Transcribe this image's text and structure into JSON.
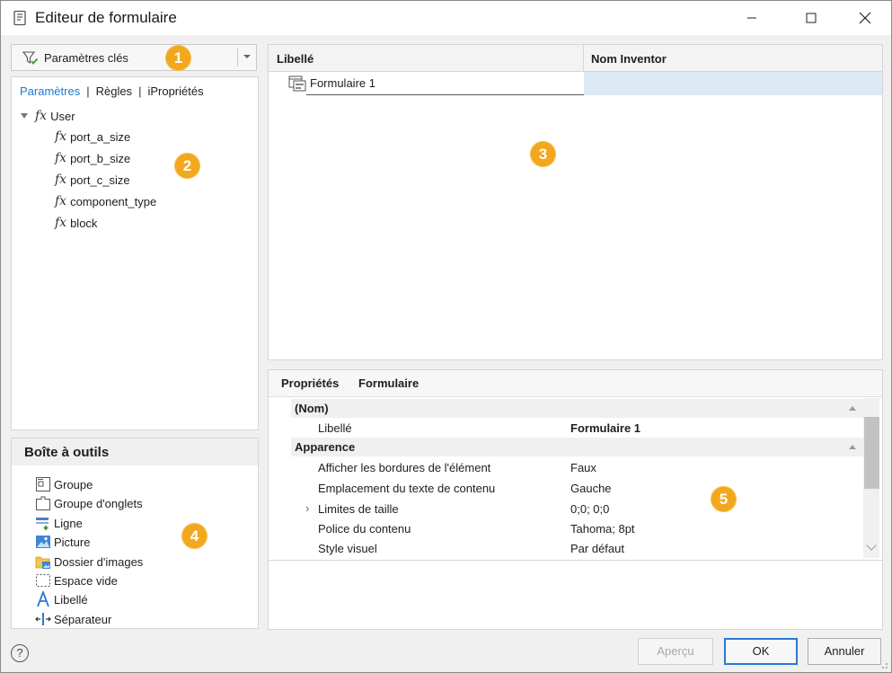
{
  "window": {
    "title": "Editeur de formulaire"
  },
  "left": {
    "dropdown_label": "Paramètres clés",
    "tabs": [
      "Paramètres",
      "Règles",
      "iPropriétés"
    ],
    "tree": {
      "root": "User",
      "items": [
        "port_a_size",
        "port_b_size",
        "port_c_size",
        "component_type",
        "block"
      ]
    }
  },
  "toolbox": {
    "title": "Boîte à outils",
    "items": [
      "Groupe",
      "Groupe d'onglets",
      "Ligne",
      "Picture",
      "Dossier d'images",
      "Espace vide",
      "Libellé",
      "Séparateur"
    ]
  },
  "grid": {
    "col1": "Libellé",
    "col2": "Nom Inventor",
    "rows": [
      {
        "label": "Formulaire 1",
        "inventor": ""
      }
    ]
  },
  "properties": {
    "header": "Propriétés",
    "subject": "Formulaire",
    "cat_nom": "(Nom)",
    "libelle_name": "Libellé",
    "libelle_value": "Formulaire 1",
    "cat_apparence": "Apparence",
    "rows": [
      {
        "name": "Afficher les bordures de l'élément",
        "value": "Faux"
      },
      {
        "name": "Emplacement du texte de contenu",
        "value": "Gauche"
      },
      {
        "name": "Limites de taille",
        "value": "0;0; 0;0"
      },
      {
        "name": "Police du contenu",
        "value": "Tahoma; 8pt"
      },
      {
        "name": "Style visuel",
        "value": "Par défaut"
      }
    ]
  },
  "buttons": {
    "apercu": "Aperçu",
    "ok": "OK",
    "annuler": "Annuler"
  },
  "help_glyph": "?",
  "badges": [
    "1",
    "2",
    "3",
    "4",
    "5"
  ],
  "colors": {
    "accent": "#1a7bd0",
    "badge": "#f2a81d",
    "selection": "#ddeaf6"
  }
}
